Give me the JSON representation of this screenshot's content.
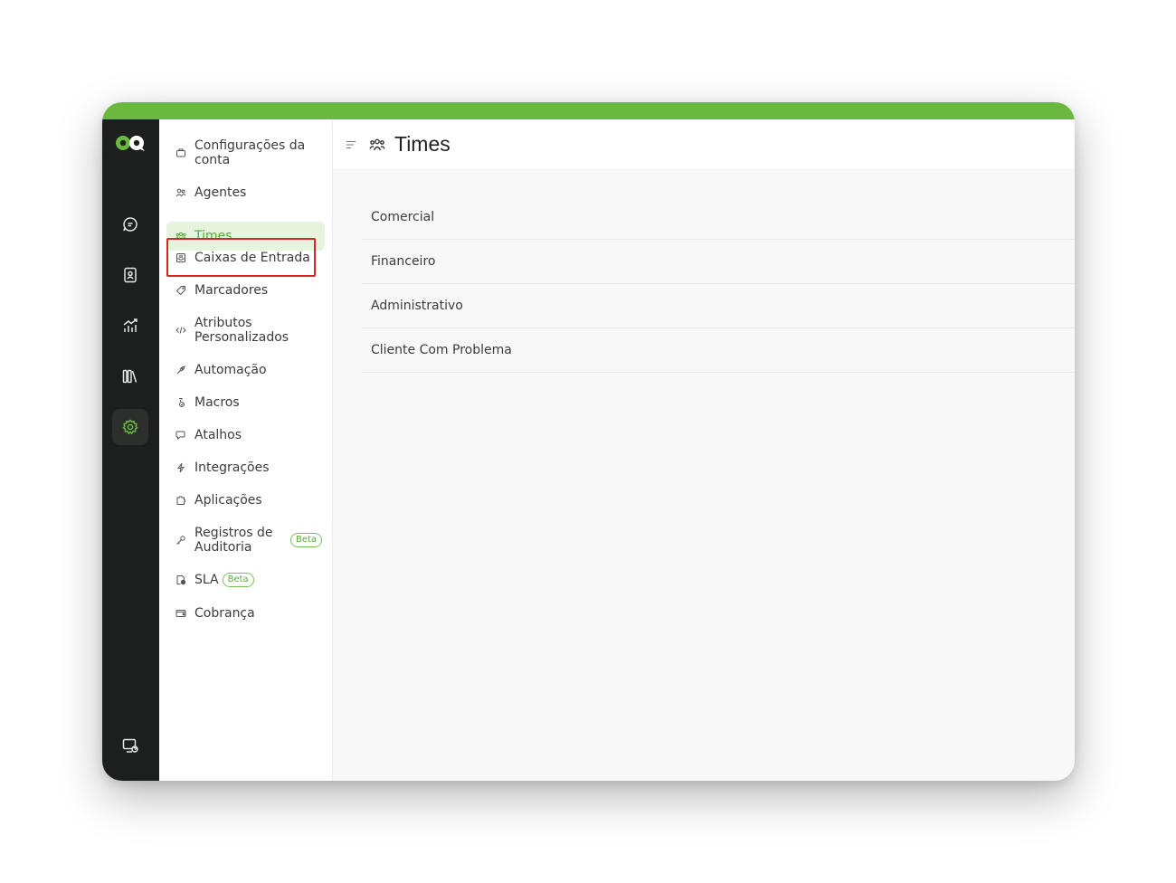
{
  "app": {
    "accent_color": "#6bb83f",
    "rail_color": "#1d1e1e"
  },
  "rail": {
    "items": [
      {
        "name": "conversations",
        "icon": "chat-bubble-icon"
      },
      {
        "name": "contacts",
        "icon": "contact-book-icon"
      },
      {
        "name": "reports",
        "icon": "chart-trend-icon"
      },
      {
        "name": "campaigns",
        "icon": "library-icon"
      },
      {
        "name": "settings",
        "icon": "gear-icon",
        "active": true
      },
      {
        "name": "help-center",
        "icon": "help-center-icon"
      }
    ]
  },
  "settings_menu": {
    "items": [
      {
        "label": "Configurações da conta",
        "icon": "briefcase-icon"
      },
      {
        "label": "Agentes",
        "icon": "people-icon"
      },
      {
        "label": "Times",
        "icon": "team-icon",
        "active": true
      },
      {
        "label": "Caixas de Entrada",
        "icon": "inbox-icon",
        "highlighted": true
      },
      {
        "label": "Marcadores",
        "icon": "tag-icon"
      },
      {
        "label": "Atributos Personalizados",
        "icon": "code-icon"
      },
      {
        "label": "Automação",
        "icon": "automation-icon"
      },
      {
        "label": "Macros",
        "icon": "macro-icon"
      },
      {
        "label": "Atalhos",
        "icon": "canned-response-icon"
      },
      {
        "label": "Integrações",
        "icon": "lightning-icon"
      },
      {
        "label": "Aplicações",
        "icon": "puzzle-icon"
      },
      {
        "label": "Registros de Auditoria",
        "icon": "key-icon",
        "badge": "Beta"
      },
      {
        "label": "SLA",
        "icon": "sla-icon",
        "badge": "Beta"
      },
      {
        "label": "Cobrança",
        "icon": "wallet-icon"
      }
    ]
  },
  "main": {
    "title": "Times",
    "title_icon": "team-icon",
    "teams": [
      "Comercial",
      "Financeiro",
      "Administrativo",
      "Cliente Com Problema"
    ]
  }
}
